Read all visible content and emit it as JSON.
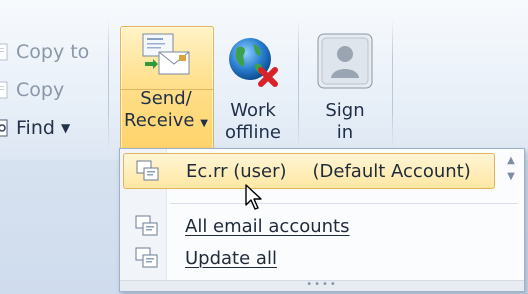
{
  "ribbon": {
    "small_buttons": [
      {
        "label": "Copy to",
        "icon": "copy-to-icon",
        "enabled": false
      },
      {
        "label": "Copy",
        "icon": "copy-icon",
        "enabled": false
      },
      {
        "label": "Find",
        "icon": "find-icon",
        "enabled": true,
        "has_dropdown": true
      }
    ],
    "send_receive": {
      "line1": "Send/",
      "line2": "Receive",
      "icon": "send-receive-icon"
    },
    "work_offline": {
      "line1": "Work",
      "line2": "offline",
      "icon": "globe-offline-icon"
    },
    "sign_in": {
      "line1": "Sign",
      "line2": "in",
      "icon": "sign-in-user-icon"
    }
  },
  "menu": {
    "items": [
      {
        "label": "Ec.rr (user)",
        "extra": "(Default Account)",
        "highlighted": true,
        "icon": "account-icon"
      },
      {
        "label": "All email accounts",
        "highlighted": false,
        "icon": "all-accounts-icon",
        "accesskey": "A"
      },
      {
        "label": "Update all",
        "highlighted": false,
        "icon": "update-all-icon",
        "accesskey": "U"
      }
    ],
    "grip": "••••"
  },
  "colors": {
    "ribbon_bg": "#e9f0f8",
    "highlight_fill": "#ffe08d",
    "highlight_border": "#e3b45a",
    "text": "#1f2f47",
    "disabled_text": "#8a97a8"
  }
}
